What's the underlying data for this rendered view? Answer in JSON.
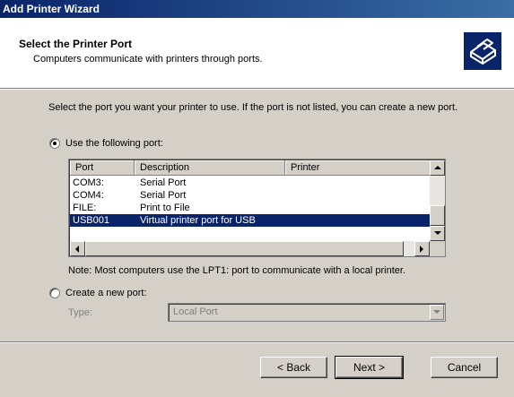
{
  "window": {
    "title": "Add Printer Wizard"
  },
  "header": {
    "title": "Select the Printer Port",
    "subtitle": "Computers communicate with printers through ports.",
    "icon": "printer-icon"
  },
  "instruction": "Select the port you want your printer to use.  If the port is not listed, you can create a new port.",
  "use_port": {
    "label": "Use the following port:",
    "checked": true
  },
  "port_table": {
    "columns": [
      "Port",
      "Description",
      "Printer"
    ],
    "rows": [
      {
        "port": "COM3:",
        "description": "Serial Port",
        "printer": ""
      },
      {
        "port": "COM4:",
        "description": "Serial Port",
        "printer": ""
      },
      {
        "port": "FILE:",
        "description": "Print to File",
        "printer": ""
      },
      {
        "port": "USB001",
        "description": "Virtual printer port for USB",
        "printer": "",
        "selected": true
      }
    ]
  },
  "note": "Note: Most computers use the LPT1: port to communicate with a local printer.",
  "create_port": {
    "label": "Create a new port:",
    "checked": false,
    "type_label": "Type:",
    "type_value": "Local Port"
  },
  "buttons": {
    "back": "< Back",
    "next": "Next >",
    "cancel": "Cancel"
  },
  "colors": {
    "selection": "#0a246a",
    "dialog": "#d4d0c8",
    "title_bar": "#0a246a"
  }
}
